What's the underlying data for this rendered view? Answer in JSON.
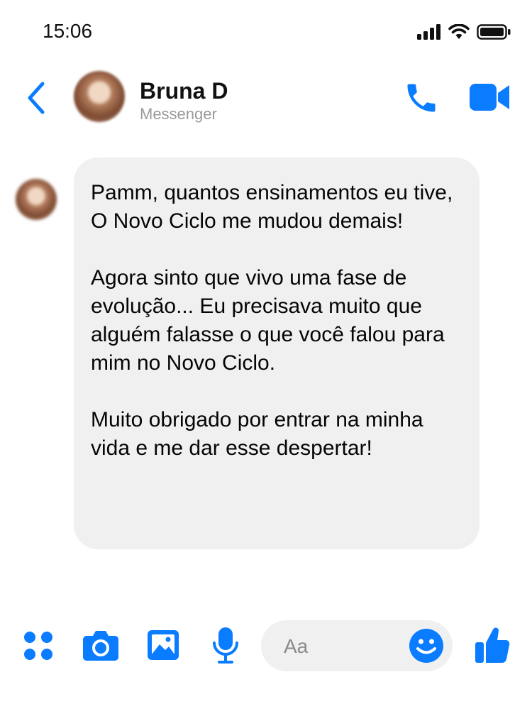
{
  "status_bar": {
    "time": "15:06",
    "icons": [
      "signal-icon",
      "wifi-icon",
      "battery-icon"
    ]
  },
  "header": {
    "back_icon": "chevron-left-icon",
    "contact_name": "Bruna D",
    "contact_subtitle": "Messenger",
    "call_icon": "phone-icon",
    "video_icon": "video-camera-icon"
  },
  "conversation": {
    "messages": [
      {
        "sender": "Bruna D",
        "paragraphs": [
          "Pamm, quantos ensinamentos eu tive, O Novo Ciclo me mudou demais!",
          "Agora sinto que vivo uma fase de evolução... Eu precisava muito que alguém falasse o que você falou para mim no Novo Ciclo.",
          "Muito obrigado por entrar na minha vida e me dar esse despertar!"
        ]
      }
    ]
  },
  "composer": {
    "placeholder": "Aa",
    "icons": [
      "apps-icon",
      "camera-icon",
      "image-icon",
      "microphone-icon",
      "emoji-icon",
      "thumbs-up-icon"
    ]
  },
  "colors": {
    "accent": "#0A7CFF",
    "bubble": "#F0F0F0",
    "subtitle": "#9A9A9A"
  }
}
